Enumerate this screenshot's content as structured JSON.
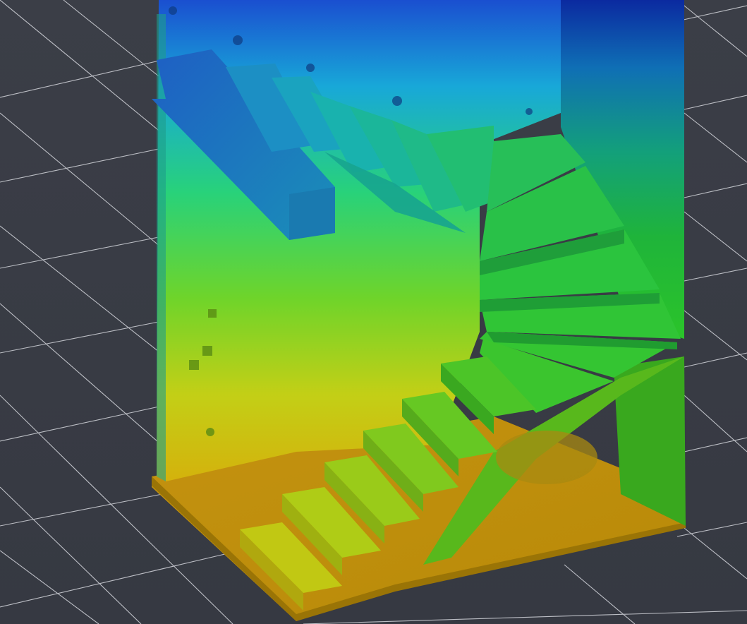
{
  "viewer": {
    "type": "point-cloud-3d-view",
    "color_scale": "height-ramp",
    "colors": {
      "background": "#3a3d46",
      "grid_line": "#d7d9de",
      "ramp_low": "#c8a400",
      "ramp_mid_low": "#a6c81a",
      "ramp_mid": "#26c52a",
      "ramp_mid_high": "#14b49a",
      "ramp_high": "#1a86d6",
      "ramp_top": "#1030a8"
    }
  },
  "scene": {
    "object": "spiral-staircase-scan",
    "grid": true
  }
}
